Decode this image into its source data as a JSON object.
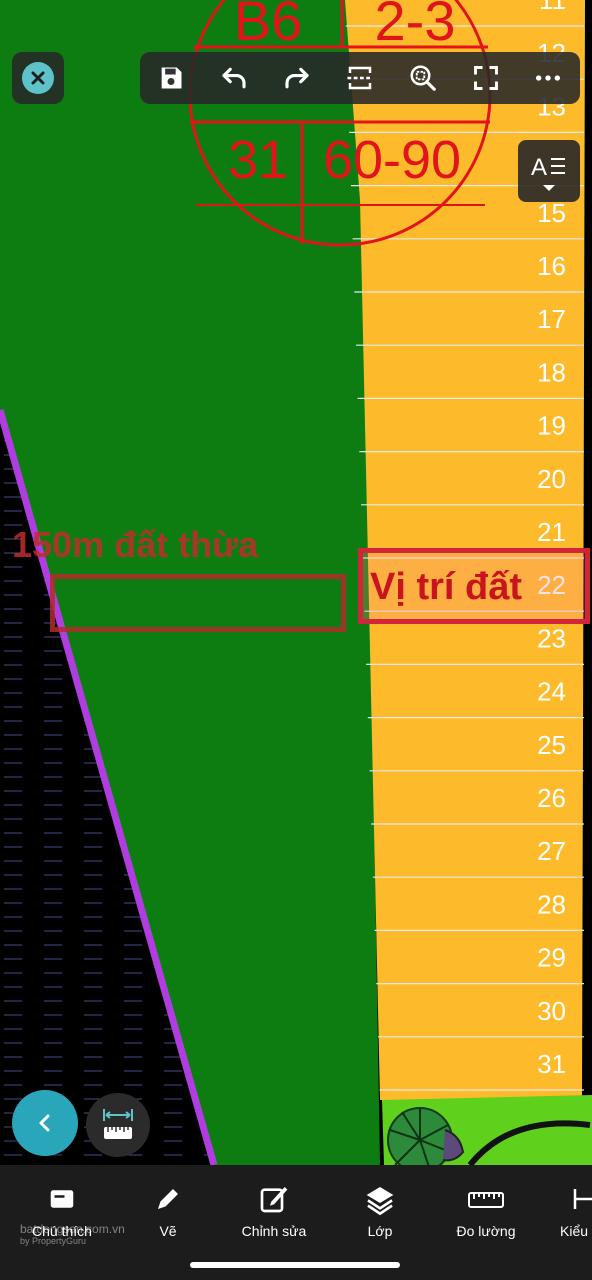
{
  "map": {
    "stamp": {
      "code": "B6",
      "block": "2-3",
      "row2": "31",
      "row2b": "60-90"
    },
    "lot_numbers": [
      "11",
      "12",
      "13",
      "15",
      "16",
      "17",
      "18",
      "19",
      "20",
      "21",
      "22",
      "23",
      "24",
      "25",
      "26",
      "27",
      "28",
      "29",
      "30",
      "31"
    ],
    "annotations": {
      "left_label": "150m đất thừa",
      "right_label": "Vị trí đất"
    },
    "colors": {
      "green_parcel": "#0d7d12",
      "yellow_lots": "#fdbb2b",
      "purple_line": "#b03de0",
      "stamp_red": "#e0141a",
      "lime": "#5fd11d"
    }
  },
  "toolbar": {
    "close_icon": "close-icon",
    "icons": [
      "save-icon",
      "undo-icon",
      "redo-icon",
      "crop-icon",
      "zoom-fit-icon",
      "fullscreen-icon",
      "more-icon"
    ]
  },
  "bottom_nav": {
    "items": [
      {
        "label": "Chú thích",
        "icon": "annotation-icon"
      },
      {
        "label": "Vẽ",
        "icon": "pen-icon"
      },
      {
        "label": "Chỉnh sửa",
        "icon": "edit-icon"
      },
      {
        "label": "Lớp",
        "icon": "layers-icon"
      },
      {
        "label": "Đo lường",
        "icon": "ruler-icon"
      },
      {
        "label": "Kiểu",
        "icon": "style-icon"
      }
    ]
  },
  "watermark": {
    "brand": "batdongsan.com.vn",
    "sub": "by PropertyGuru"
  }
}
